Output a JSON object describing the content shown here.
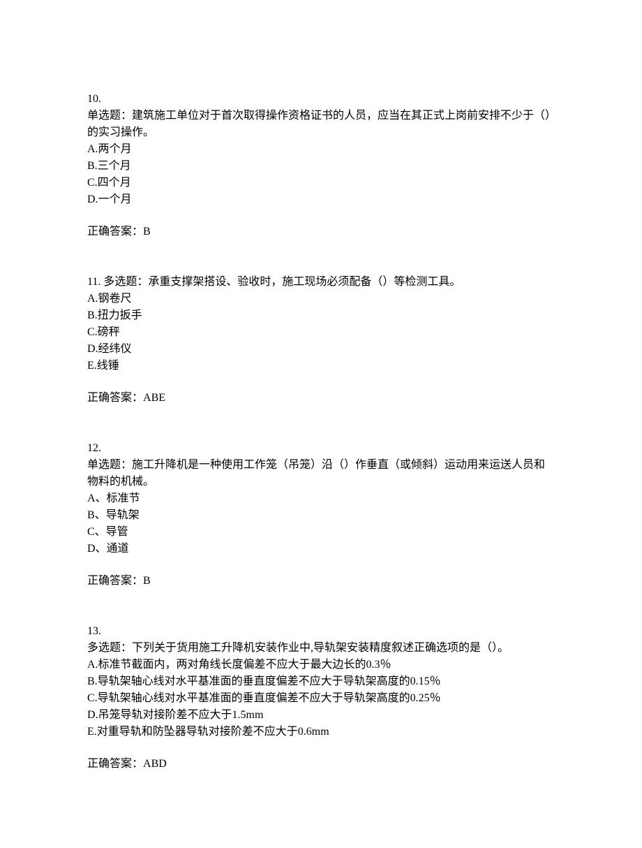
{
  "questions": [
    {
      "number": "10.",
      "type_label": "单选题：",
      "stem": "建筑施工单位对于首次取得操作资格证书的人员，应当在其正式上岗前安排不少于（）的实习操作。",
      "options": [
        "A.两个月",
        "B.三个月",
        "C.四个月",
        "D.一个月"
      ],
      "answer_label": "正确答案：",
      "answer": "B"
    },
    {
      "number": "11.",
      "type_label": " 多选题：",
      "stem": "承重支撑架搭设、验收时，施工现场必须配备（）等检测工具。",
      "options": [
        "A.钢卷尺",
        "B.扭力扳手",
        "C.磅秤",
        "D.经纬仪",
        "E.线锤"
      ],
      "answer_label": "正确答案：",
      "answer": "ABE"
    },
    {
      "number": "12.",
      "type_label": "单选题：",
      "stem": "施工升降机是一种使用工作笼（吊笼）沿（）作垂直（或倾斜）运动用来运送人员和物料的机械。",
      "options": [
        "A、标准节",
        "B、导轨架",
        "C、导管",
        "D、通道"
      ],
      "answer_label": "正确答案：",
      "answer": "B"
    },
    {
      "number": "13.",
      "type_label": "多选题：",
      "stem": "下列关于货用施工升降机安装作业中,导轨架安装精度叙述正确选项的是（）。",
      "options": [
        "A.标准节截面内，两对角线长度偏差不应大于最大边长的0.3％",
        "B.导轨架轴心线对水平基准面的垂直度偏差不应大于导轨架高度的0.15％",
        "C.导轨架轴心线对水平基准面的垂直度偏差不应大于导轨架高度的0.25％",
        "D.吊笼导轨对接阶差不应大于1.5mm",
        "E.对重导轨和防坠器导轨对接阶差不应大于0.6mm"
      ],
      "answer_label": "正确答案：",
      "answer": "ABD"
    }
  ]
}
